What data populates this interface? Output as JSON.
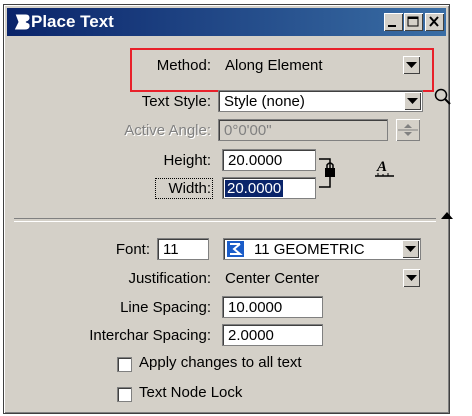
{
  "window": {
    "title": "Place Text",
    "controls": [
      "minimize",
      "maximize",
      "close"
    ]
  },
  "method": {
    "label": "Method:",
    "value": "Along Element"
  },
  "text_style": {
    "label": "Text Style:",
    "value": "Style (none)"
  },
  "active_angle": {
    "label": "Active Angle:",
    "value": "0°0'00\""
  },
  "height": {
    "label": "Height:",
    "value": "20.0000"
  },
  "width": {
    "label": "Width:",
    "value": "20.0000"
  },
  "font": {
    "label": "Font:",
    "number": "11",
    "value": "11  GEOMETRIC"
  },
  "justification": {
    "label": "Justification:",
    "value": "Center Center"
  },
  "line_spacing": {
    "label": "Line Spacing:",
    "value": "10.0000"
  },
  "interchar_spacing": {
    "label": "Interchar Spacing:",
    "value": "2.0000"
  },
  "apply_changes": {
    "label": "Apply changes to all text",
    "checked": false
  },
  "text_node_lock": {
    "label": "Text Node Lock",
    "checked": false
  },
  "colors": {
    "title_bar": "#0a246a",
    "highlight": "#e8202a",
    "dialog": "#d4d0c8"
  }
}
